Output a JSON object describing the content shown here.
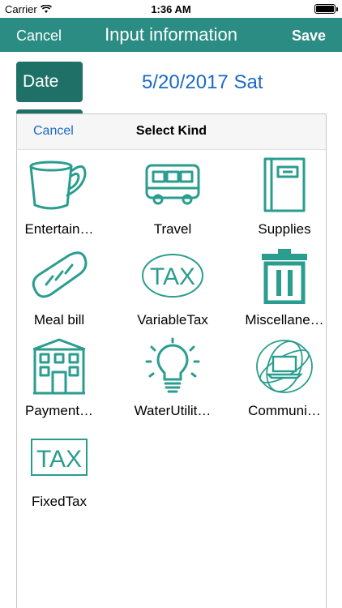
{
  "status_bar": {
    "carrier": "Carrier",
    "time": "1:36 AM"
  },
  "nav": {
    "cancel_label": "Cancel",
    "title": "Input information",
    "save_label": "Save"
  },
  "date_row": {
    "label": "Date",
    "value": "5/20/2017 Sat"
  },
  "sheet": {
    "cancel_label": "Cancel",
    "title": "Select Kind",
    "items": [
      {
        "label": "Entertain…",
        "icon": "cup-icon"
      },
      {
        "label": "Travel",
        "icon": "bus-icon"
      },
      {
        "label": "Supplies",
        "icon": "notebook-icon"
      },
      {
        "label": "Meal bill",
        "icon": "bread-icon"
      },
      {
        "label": "VariableTax",
        "icon": "tax-oval-icon",
        "icon_text": "TAX"
      },
      {
        "label": "Miscellane…",
        "icon": "trash-icon"
      },
      {
        "label": "Payment…",
        "icon": "building-icon"
      },
      {
        "label": "WaterUtilit…",
        "icon": "lightbulb-icon"
      },
      {
        "label": "Communi…",
        "icon": "laptop-globe-icon"
      },
      {
        "label": "FixedTax",
        "icon": "tax-rect-icon",
        "icon_text": "TAX"
      }
    ]
  },
  "colors": {
    "nav_bg": "#2a8c82",
    "date_button_bg": "#1f7168",
    "accent_blue": "#1a69c7",
    "icon_teal": "#2a9d8f"
  }
}
